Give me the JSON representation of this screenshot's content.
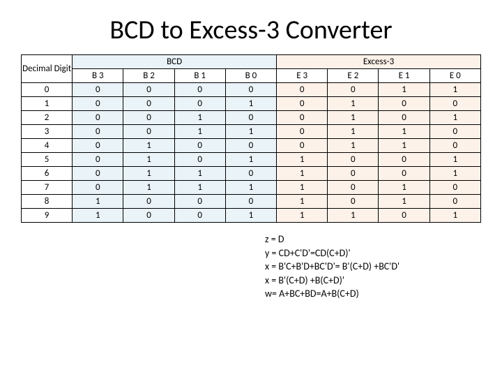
{
  "title": "BCD to Excess-3 Converter",
  "headers": {
    "decimal": "Decimal Digit",
    "bcd": "BCD",
    "excess": "Excess-3",
    "b3": "B 3",
    "b2": "B 2",
    "b1": "B 1",
    "b0": "B 0",
    "e3": "E 3",
    "e2": "E 2",
    "e1": "E 1",
    "e0": "E 0"
  },
  "chart_data": {
    "type": "table",
    "title": "BCD to Excess-3 Converter",
    "columns": [
      "Decimal Digit",
      "B3",
      "B2",
      "B1",
      "B0",
      "E3",
      "E2",
      "E1",
      "E0"
    ],
    "rows": [
      {
        "d": "0",
        "b3": "0",
        "b2": "0",
        "b1": "0",
        "b0": "0",
        "e3": "0",
        "e2": "0",
        "e1": "1",
        "e0": "1"
      },
      {
        "d": "1",
        "b3": "0",
        "b2": "0",
        "b1": "0",
        "b0": "1",
        "e3": "0",
        "e2": "1",
        "e1": "0",
        "e0": "0"
      },
      {
        "d": "2",
        "b3": "0",
        "b2": "0",
        "b1": "1",
        "b0": "0",
        "e3": "0",
        "e2": "1",
        "e1": "0",
        "e0": "1"
      },
      {
        "d": "3",
        "b3": "0",
        "b2": "0",
        "b1": "1",
        "b0": "1",
        "e3": "0",
        "e2": "1",
        "e1": "1",
        "e0": "0"
      },
      {
        "d": "4",
        "b3": "0",
        "b2": "1",
        "b1": "0",
        "b0": "0",
        "e3": "0",
        "e2": "1",
        "e1": "1",
        "e0": "0"
      },
      {
        "d": "5",
        "b3": "0",
        "b2": "1",
        "b1": "0",
        "b0": "1",
        "e3": "1",
        "e2": "0",
        "e1": "0",
        "e0": "1"
      },
      {
        "d": "6",
        "b3": "0",
        "b2": "1",
        "b1": "1",
        "b0": "0",
        "e3": "1",
        "e2": "0",
        "e1": "0",
        "e0": "1"
      },
      {
        "d": "7",
        "b3": "0",
        "b2": "1",
        "b1": "1",
        "b0": "1",
        "e3": "1",
        "e2": "0",
        "e1": "1",
        "e0": "0"
      },
      {
        "d": "8",
        "b3": "1",
        "b2": "0",
        "b1": "0",
        "b0": "0",
        "e3": "1",
        "e2": "0",
        "e1": "1",
        "e0": "0"
      },
      {
        "d": "9",
        "b3": "1",
        "b2": "0",
        "b1": "0",
        "b0": "1",
        "e3": "1",
        "e2": "1",
        "e1": "0",
        "e0": "1"
      }
    ]
  },
  "formulas": {
    "z": "z = D",
    "y": "y = CD+C'D'=CD(C+D)'",
    "x1": "x = B'C+B'D+BC'D'= B'(C+D) +BC'D'",
    "x2": "x  = B'(C+D) +B(C+D)'",
    "w": "w= A+BC+BD=A+B(C+D)"
  }
}
